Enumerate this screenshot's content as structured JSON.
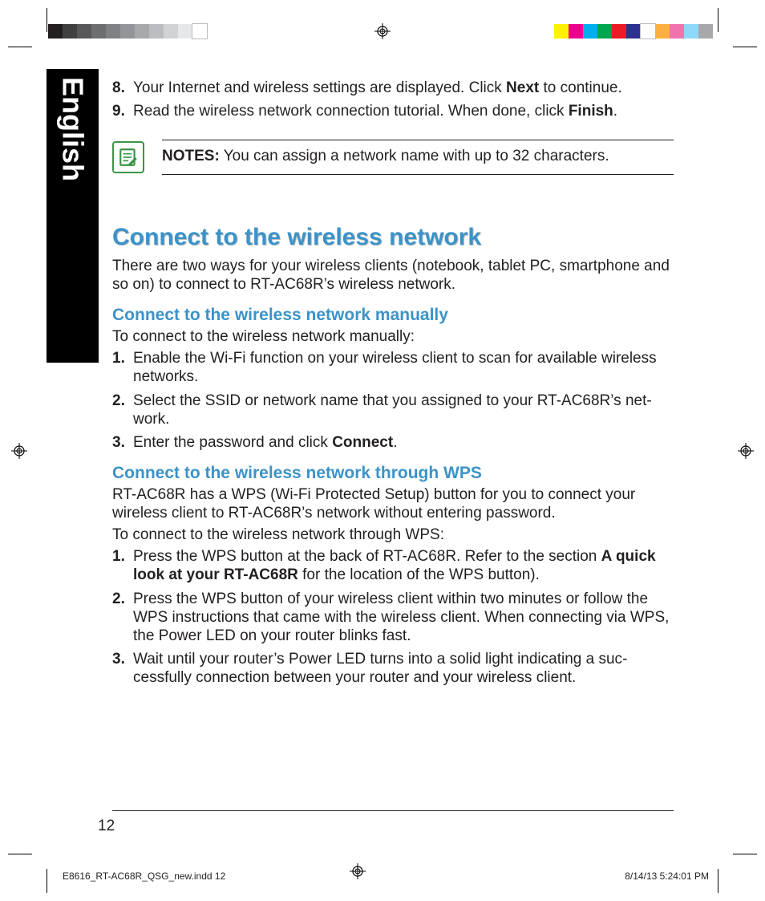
{
  "sideTab": {
    "language": "English"
  },
  "topList": [
    {
      "num": "8.",
      "parts": [
        "Your Internet and wireless settings are displayed. Click ",
        {
          "b": "Next"
        },
        " to continue."
      ]
    },
    {
      "num": "9.",
      "parts": [
        "Read the wireless network connection tutorial. When done, click ",
        {
          "b": "Finish"
        },
        "."
      ]
    }
  ],
  "notes": {
    "label": "NOTES:",
    "text": "  You can assign a network name with up to 32 characters."
  },
  "section": {
    "heading": "Connect to the wireless network",
    "intro": "There are two ways for your wireless clients (notebook, tablet PC, smartphone and so on) to connect to RT-AC68R’s wireless network."
  },
  "manual": {
    "heading": "Connect to the wireless network manually",
    "intro": "To connect to the wireless network manually:",
    "steps": [
      {
        "num": "1.",
        "parts": [
          "Enable the Wi-Fi function on your wireless client to scan for available wireless networks."
        ]
      },
      {
        "num": "2.",
        "parts": [
          "Select the SSID or network name that you assigned to your RT-AC68R’s net­work."
        ]
      },
      {
        "num": "3.",
        "parts": [
          "Enter the password and click ",
          {
            "b": "Connect"
          },
          "."
        ]
      }
    ]
  },
  "wps": {
    "heading": "Connect to the wireless network through WPS",
    "intro1": "RT-AC68R has a WPS (Wi-Fi Protected Setup) button for you to connect your wireless client to RT-AC68R’s network without entering password.",
    "intro2": "To connect to the wireless network through WPS:",
    "steps": [
      {
        "num": "1.",
        "parts": [
          "Press the WPS button at the back of RT-AC68R. Refer to the section ",
          {
            "b": "A quick look at your RT-AC68R"
          },
          " for the location of the WPS button)."
        ]
      },
      {
        "num": "2.",
        "parts": [
          "Press the WPS button of your wireless client within two minutes or follow the WPS instructions that came with the wireless client. When connecting via WPS, the Power LED on your router blinks fast."
        ]
      },
      {
        "num": "3.",
        "parts": [
          "Wait until your router’s Power LED turns into a solid light indicating a suc­cessfully connection between your router and your wireless client."
        ]
      }
    ]
  },
  "pageNumber": "12",
  "slug": {
    "file": "E8616_RT-AC68R_QSG_new.indd   12",
    "datetime": "8/14/13   5:24:01 PM"
  },
  "colorbars": {
    "greys": [
      "#231f20",
      "#404041",
      "#58585a",
      "#6d6e70",
      "#808184",
      "#949599",
      "#a7a9ab",
      "#bcbdc0",
      "#d0d2d3",
      "#e6e7e8",
      "#ffffff"
    ],
    "colors": [
      "#fff200",
      "#ec008b",
      "#00adee",
      "#00a650",
      "#ed1b24",
      "#2e3092",
      "#ffffff",
      "#fcb040",
      "#f173ac",
      "#8ed8f8",
      "#a6a8ab"
    ]
  }
}
